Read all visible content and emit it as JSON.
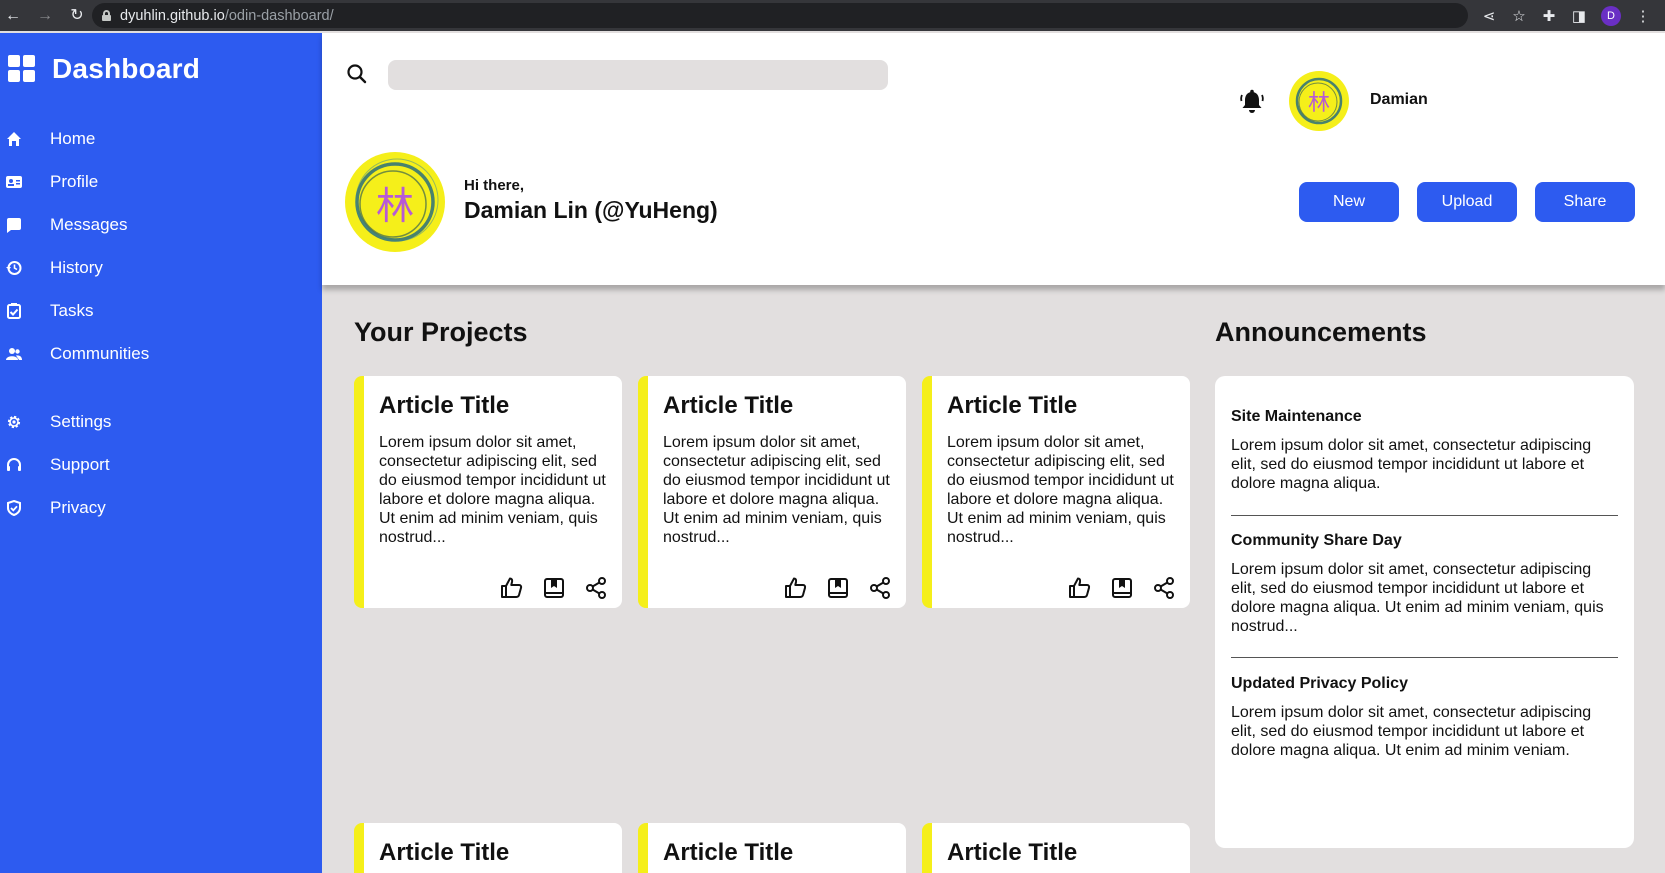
{
  "browser": {
    "url_host": "dyuhlin.github.io",
    "url_path": "/odin-dashboard/",
    "profile_initial": "D"
  },
  "sidebar": {
    "brand": "Dashboard",
    "items": [
      {
        "label": "Home",
        "icon": "home-icon"
      },
      {
        "label": "Profile",
        "icon": "id-card-icon"
      },
      {
        "label": "Messages",
        "icon": "message-icon"
      },
      {
        "label": "History",
        "icon": "history-icon"
      },
      {
        "label": "Tasks",
        "icon": "clipboard-check-icon"
      },
      {
        "label": "Communities",
        "icon": "people-icon"
      }
    ],
    "settings_items": [
      {
        "label": "Settings",
        "icon": "gear-icon"
      },
      {
        "label": "Support",
        "icon": "headset-icon"
      },
      {
        "label": "Privacy",
        "icon": "shield-icon"
      }
    ]
  },
  "header": {
    "search_placeholder": "",
    "user_name": "Damian",
    "greeting": "Hi there,",
    "full_name": "Damian Lin (@YuHeng)",
    "avatar_char": "林",
    "buttons": {
      "new": "New",
      "upload": "Upload",
      "share": "Share"
    }
  },
  "projects": {
    "title": "Your Projects",
    "cards": [
      {
        "title": "Article Title",
        "body": "Lorem ipsum dolor sit amet, consectetur adipiscing elit, sed do eiusmod tempor incididunt ut labore et dolore magna aliqua. Ut enim ad minim veniam, quis nostrud..."
      },
      {
        "title": "Article Title",
        "body": "Lorem ipsum dolor sit amet, consectetur adipiscing elit, sed do eiusmod tempor incididunt ut labore et dolore magna aliqua. Ut enim ad minim veniam, quis nostrud..."
      },
      {
        "title": "Article Title",
        "body": "Lorem ipsum dolor sit amet, consectetur adipiscing elit, sed do eiusmod tempor incididunt ut labore et dolore magna aliqua. Ut enim ad minim veniam, quis nostrud..."
      },
      {
        "title": "Article Title"
      },
      {
        "title": "Article Title"
      },
      {
        "title": "Article Title"
      }
    ]
  },
  "announcements": {
    "title": "Announcements",
    "items": [
      {
        "title": "Site Maintenance",
        "body": "Lorem ipsum dolor sit amet, consectetur adipiscing elit, sed do eiusmod tempor incididunt ut labore et dolore magna aliqua."
      },
      {
        "title": "Community Share Day",
        "body": "Lorem ipsum dolor sit amet, consectetur adipiscing elit, sed do eiusmod tempor incididunt ut labore et dolore magna aliqua. Ut enim ad minim veniam, quis nostrud..."
      },
      {
        "title": "Updated Privacy Policy",
        "body": "Lorem ipsum dolor sit amet, consectetur adipiscing elit, sed do eiusmod tempor incididunt ut labore et dolore magna aliqua. Ut enim ad minim veniam."
      }
    ]
  },
  "colors": {
    "sidebar": "#2d5bf0",
    "accent_yellow": "#f5ef1a",
    "background": "#e2dfdf",
    "avatar_purple": "#b75ad6"
  }
}
